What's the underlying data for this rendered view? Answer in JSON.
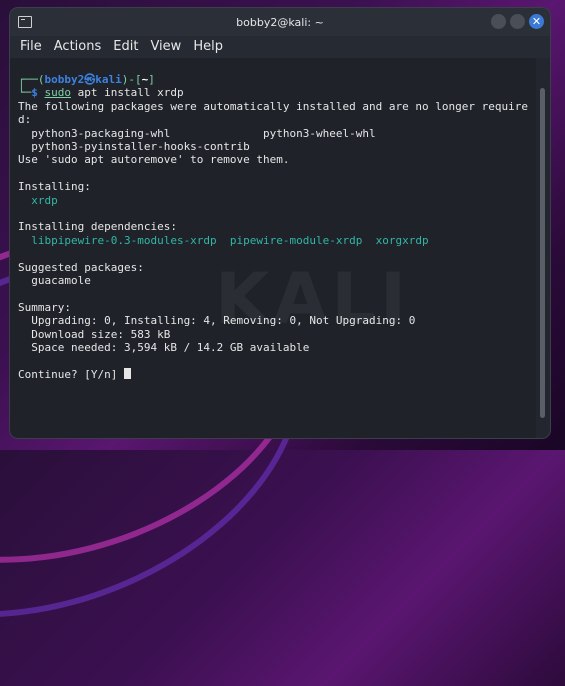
{
  "window": {
    "title": "bobby2@kali: ~"
  },
  "menu": [
    "File",
    "Actions",
    "Edit",
    "View",
    "Help"
  ],
  "watermark": "KALI",
  "terminal": {
    "prompt_open": "┌──(",
    "prompt_user": "bobby2㉿kali",
    "prompt_close": ")-[",
    "prompt_dir": "~",
    "prompt_end": "]",
    "line2_prefix": "└─",
    "dollar": "$ ",
    "cmd_sudo": "sudo",
    "cmd_rest": " apt install xrdp",
    "lines": [
      "The following packages were automatically installed and are no longer require",
      "d:",
      "  python3-packaging-whl              python3-wheel-whl",
      "  python3-pyinstaller-hooks-contrib",
      "Use 'sudo apt autoremove' to remove them.",
      "",
      "Installing:"
    ],
    "install_pkg": "  xrdp",
    "deps_header": "Installing dependencies:",
    "deps_pkgs": "  libpipewire-0.3-modules-xrdp  pipewire-module-xrdp  xorgxrdp",
    "suggest_header": "Suggested packages:",
    "suggest_pkg": "  guacamole",
    "summary_header": "Summary:",
    "summary": [
      "  Upgrading: 0, Installing: 4, Removing: 0, Not Upgrading: 0",
      "  Download size: 583 kB",
      "  Space needed: 3,594 kB / 14.2 GB available"
    ],
    "continue": "Continue? [Y/n] "
  }
}
